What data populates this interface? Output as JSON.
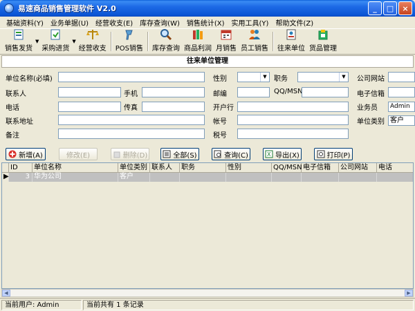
{
  "window": {
    "title": "易速商品销售管理软件  V2.0",
    "buttons": {
      "minimize": "_",
      "maximize": "□",
      "close": "×"
    }
  },
  "menu": [
    "基础资料(Y)",
    "业务单据(U)",
    "经营收支(E)",
    "库存查询(W)",
    "销售统计(X)",
    "实用工具(Y)",
    "帮助文件(Z)"
  ],
  "toolbar": {
    "sales_out": "销售发货",
    "purchase_in": "采购进货",
    "income_expense": "经营收支",
    "pos": "POS销售",
    "stock_query": "库存查询",
    "product_profit": "商品利润",
    "monthly_sales": "月销售",
    "staff_sales": "员工销售",
    "partners": "往来单位",
    "goods_mgmt": "货品管理"
  },
  "module_title": "往来单位管理",
  "form": {
    "unit_name_label": "单位名称(必填)",
    "contact_label": "联系人",
    "mobile_label": "手机",
    "phone_label": "电话",
    "fax_label": "传真",
    "address_label": "联系地址",
    "remark_label": "备注",
    "gender_label": "性别",
    "position_label": "职务",
    "website_label": "公司网站",
    "zip_label": "邮编",
    "qq_label": "QQ/MSN",
    "email_label": "电子信箱",
    "bank_label": "开户行",
    "clerk_label": "业务员",
    "account_label": "帐号",
    "type_label": "单位类别",
    "tax_label": "税号",
    "clerk_value": "Admin",
    "type_value": "客户"
  },
  "actions": {
    "add": "新增(A)",
    "edit": "修改(E)",
    "delete": "删除(D)",
    "all": "全部(S)",
    "query": "查询(C)",
    "export": "导出(X)",
    "print": "打印(P)"
  },
  "grid": {
    "headers": [
      "ID",
      "单位名称",
      "单位类别",
      "联系人",
      "职务",
      "性别",
      "QQ/MSN",
      "电子信箱",
      "公司网站",
      "电话"
    ],
    "rows": [
      {
        "indicator": "▶",
        "id": "3",
        "name": "华为公司",
        "type": "客户"
      }
    ]
  },
  "status": {
    "user": "当前用户: Admin",
    "count": "当前共有 1 条记录"
  }
}
